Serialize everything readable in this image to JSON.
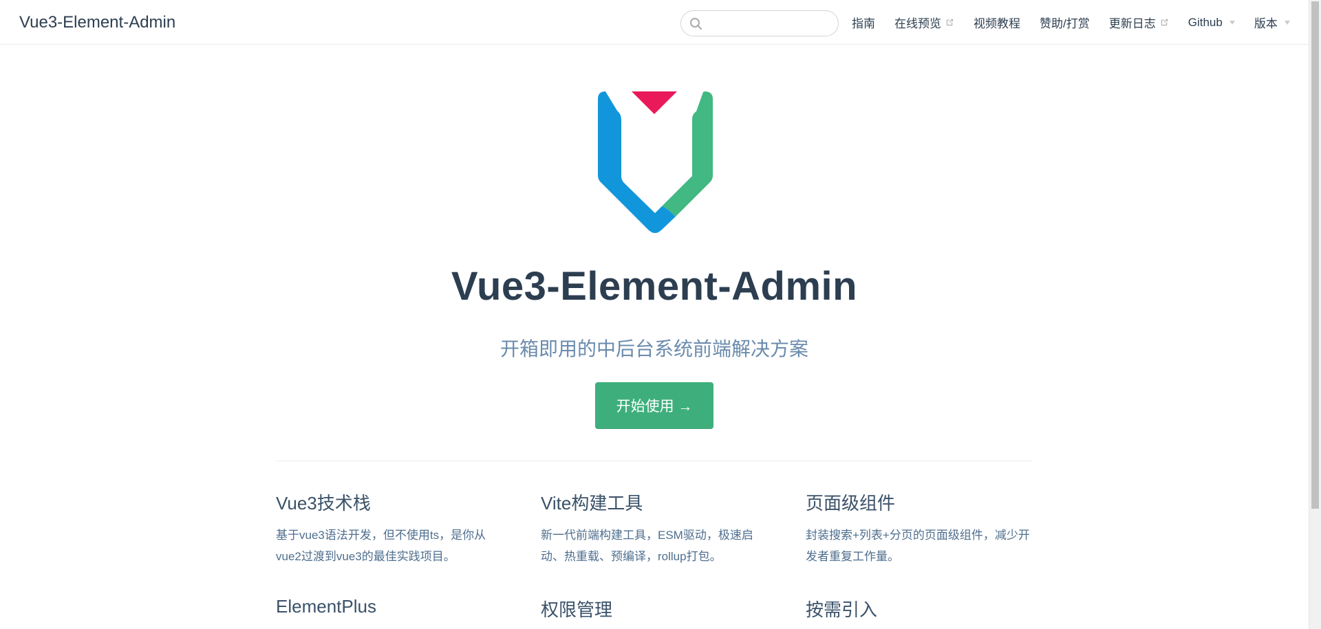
{
  "navbar": {
    "site_name": "Vue3-Element-Admin",
    "search": {
      "placeholder": "",
      "value": ""
    },
    "links": [
      {
        "label": "指南",
        "external": false,
        "dropdown": false
      },
      {
        "label": "在线预览",
        "external": true,
        "dropdown": false
      },
      {
        "label": "视频教程",
        "external": false,
        "dropdown": false
      },
      {
        "label": "赞助/打赏",
        "external": false,
        "dropdown": false
      },
      {
        "label": "更新日志",
        "external": true,
        "dropdown": false
      },
      {
        "label": "Github",
        "external": false,
        "dropdown": true
      },
      {
        "label": "版本",
        "external": false,
        "dropdown": true
      }
    ]
  },
  "hero": {
    "title": "Vue3-Element-Admin",
    "description": "开箱即用的中后台系统前端解决方案",
    "action_label": "开始使用 →"
  },
  "features": [
    {
      "title": "Vue3技术栈",
      "details": "基于vue3语法开发，但不使用ts，是你从vue2过渡到vue3的最佳实践项目。"
    },
    {
      "title": "Vite构建工具",
      "details": "新一代前端构建工具，ESM驱动，极速启动、热重载、预编译，rollup打包。"
    },
    {
      "title": "页面级组件",
      "details": "封装搜索+列表+分页的页面级组件，减少开发者重复工作量。"
    },
    {
      "title": "ElementPlus",
      "details": ""
    },
    {
      "title": "权限管理",
      "details": ""
    },
    {
      "title": "按需引入",
      "details": ""
    }
  ],
  "colors": {
    "accent": "#3eaf7c",
    "logo_blue": "#1296db",
    "logo_green": "#42b883",
    "logo_red": "#e9195a",
    "text": "#2c3e50",
    "muted": "#6a8bad"
  }
}
